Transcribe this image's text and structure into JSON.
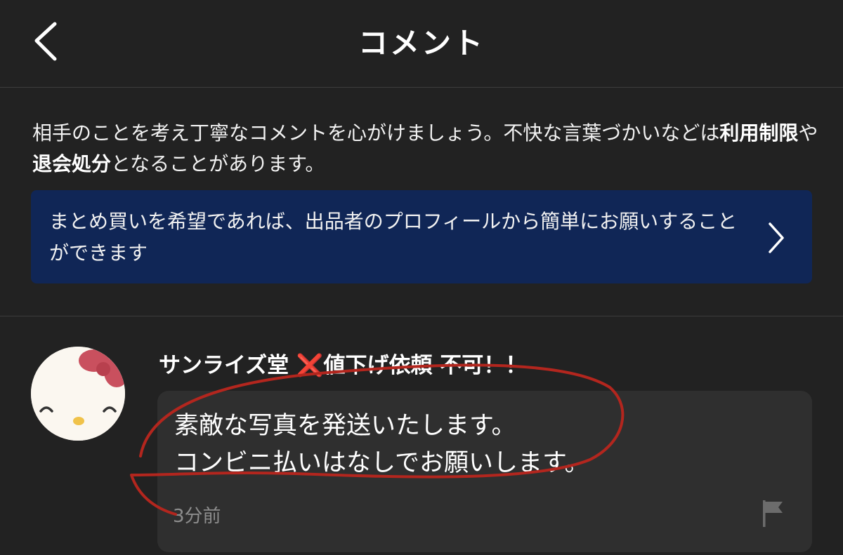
{
  "header": {
    "title": "コメント",
    "back_icon": "chevron-left-icon"
  },
  "notice": {
    "part1": "相手のことを考え丁寧なコメントを心がけましょう。不快な言葉づかいなどは",
    "bold1": "利用制限",
    "part2": "や",
    "bold2": "退会処分",
    "part3": "となることがあります。"
  },
  "banner": {
    "text": "まとめ買いを希望であれば、出品者のプロフィールから簡単にお願いすることができます",
    "chevron_icon": "chevron-right-icon",
    "background": "#102656"
  },
  "comment": {
    "username_prefix": "サンライズ堂 ",
    "username_emoji": "❌",
    "username_suffix": "値下げ依頼 不可！！",
    "text": "素敵な写真を発送いたします。\nコンビニ払いはなしでお願いします。",
    "timestamp": "3分前",
    "flag_icon": "flag-icon",
    "avatar_icon": "hello-kitty-avatar"
  },
  "colors": {
    "background": "#222222",
    "bubble": "#2f2f2f",
    "annotation_stroke": "#b3261e"
  }
}
